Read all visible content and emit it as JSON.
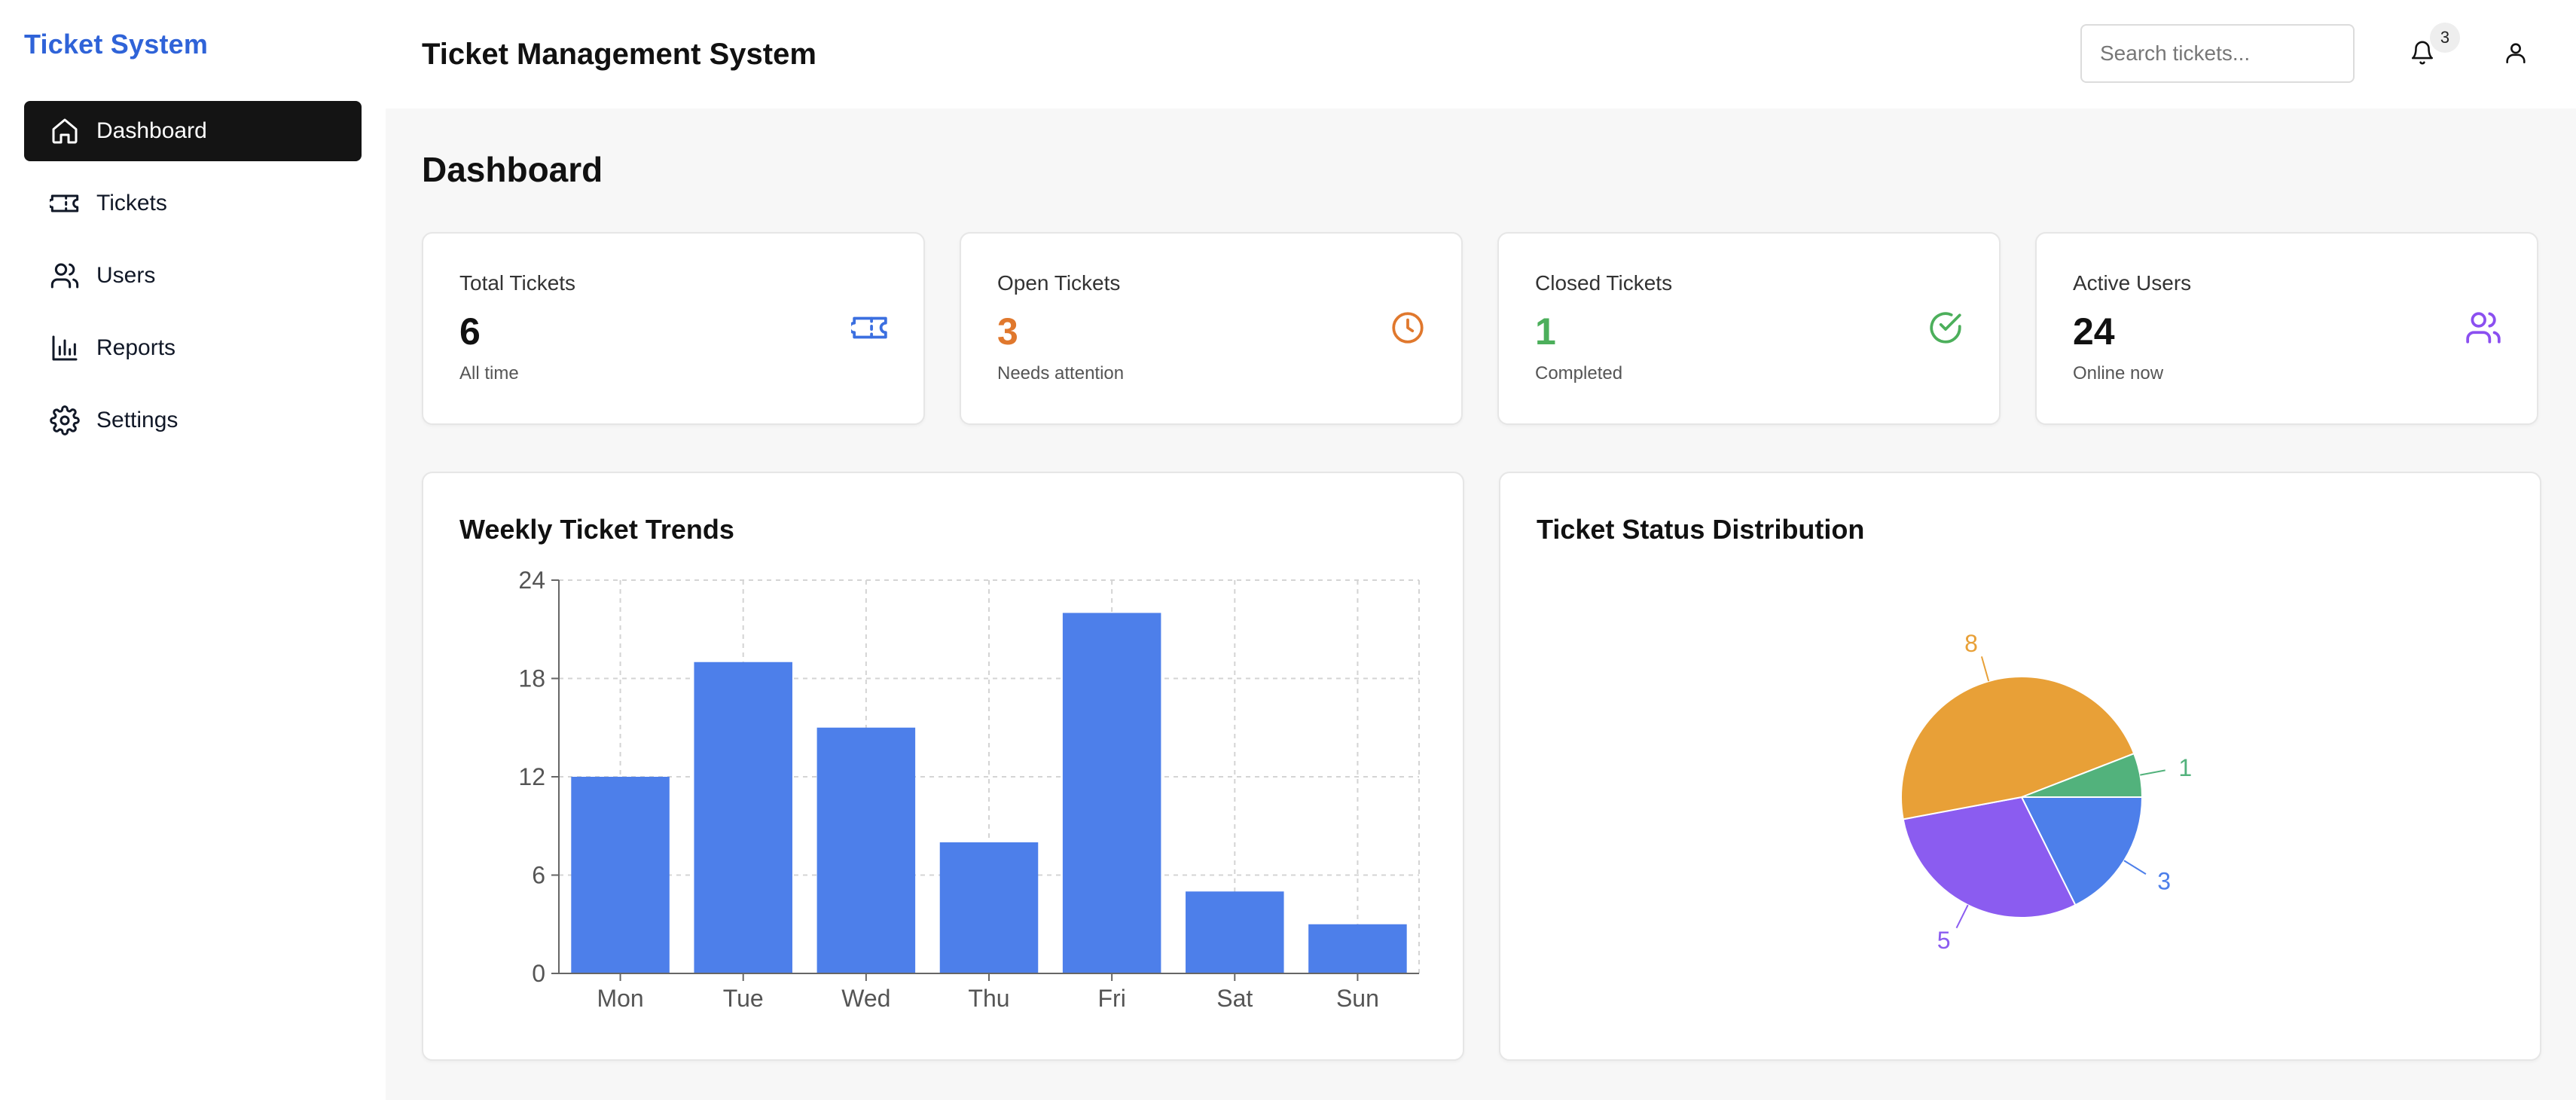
{
  "sidebar": {
    "brand": "Ticket System",
    "items": [
      {
        "label": "Dashboard",
        "icon": "home-icon",
        "active": true
      },
      {
        "label": "Tickets",
        "icon": "ticket-icon",
        "active": false
      },
      {
        "label": "Users",
        "icon": "users-icon",
        "active": false
      },
      {
        "label": "Reports",
        "icon": "bar-chart-icon",
        "active": false
      },
      {
        "label": "Settings",
        "icon": "gear-icon",
        "active": false
      }
    ]
  },
  "header": {
    "title": "Ticket Management System",
    "search_placeholder": "Search tickets...",
    "notification_count": "3"
  },
  "page": {
    "title": "Dashboard"
  },
  "stats": [
    {
      "label": "Total Tickets",
      "value": "6",
      "sub": "All time",
      "icon": "ticket-icon",
      "color": "#3b6fe0"
    },
    {
      "label": "Open Tickets",
      "value": "3",
      "sub": "Needs attention",
      "icon": "clock-icon",
      "color": "#e0782d"
    },
    {
      "label": "Closed Tickets",
      "value": "1",
      "sub": "Completed",
      "icon": "check-circle-icon",
      "color": "#4caf5b"
    },
    {
      "label": "Active Users",
      "value": "24",
      "sub": "Online now",
      "icon": "users-icon",
      "color": "#8b4ff0"
    }
  ],
  "charts": {
    "weekly_title": "Weekly Ticket Trends",
    "status_title": "Ticket Status Distribution"
  },
  "chart_data": [
    {
      "type": "bar",
      "title": "Weekly Ticket Trends",
      "categories": [
        "Mon",
        "Tue",
        "Wed",
        "Thu",
        "Fri",
        "Sat",
        "Sun"
      ],
      "values": [
        12,
        19,
        15,
        8,
        22,
        5,
        3
      ],
      "ylim": [
        0,
        24
      ],
      "yticks": [
        0,
        6,
        12,
        18,
        24
      ],
      "grid": true,
      "color": "#4d7fea"
    },
    {
      "type": "pie",
      "title": "Ticket Status Distribution",
      "slices": [
        {
          "value": 3,
          "color": "#4d7fea"
        },
        {
          "value": 5,
          "color": "#8b5cf0"
        },
        {
          "value": 8,
          "color": "#e8a037"
        },
        {
          "value": 1,
          "color": "#52b27c"
        }
      ]
    }
  ]
}
